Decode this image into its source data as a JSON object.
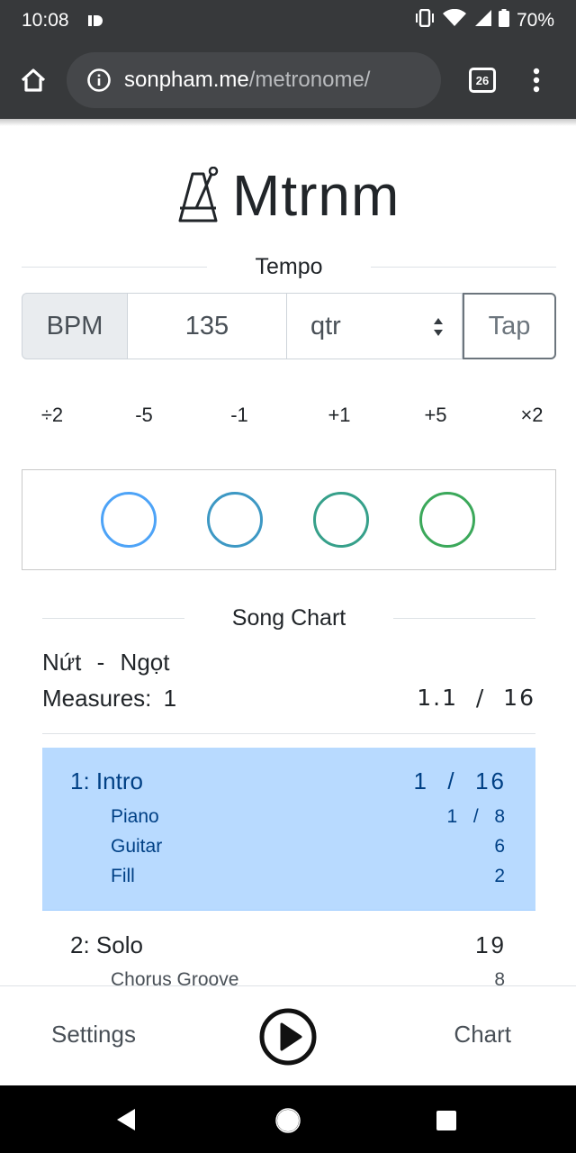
{
  "status_bar": {
    "time": "10:08",
    "battery": "70%"
  },
  "browser": {
    "url_host": "sonpham.me",
    "url_path": "/metronome/",
    "tab_count": "26"
  },
  "app": {
    "title": "Mtrnm"
  },
  "tempo": {
    "section_title": "Tempo",
    "bpm_label": "BPM",
    "bpm_value": "135",
    "note_value": "qtr",
    "tap_label": "Tap",
    "adjust_buttons": [
      "÷2",
      "-5",
      "-1",
      "+1",
      "+5",
      "×2"
    ]
  },
  "beats": {
    "count": 4,
    "colors": [
      "#4da3f7",
      "#3d98c4",
      "#36a08a",
      "#3ba85a"
    ]
  },
  "song_chart": {
    "section_title": "Song Chart",
    "artist": "Nứt",
    "separator": "-",
    "song": "Ngọt",
    "measures_label": "Measures:",
    "measures_value": "1",
    "position": "1.1  /  16",
    "sections": [
      {
        "name": "1: Intro",
        "count": "1  /  16",
        "active": true,
        "parts": [
          {
            "name": "Piano",
            "count": "1  /  8"
          },
          {
            "name": "Guitar",
            "count": "6"
          },
          {
            "name": "Fill",
            "count": "2"
          }
        ]
      },
      {
        "name": "2: Solo",
        "count": "19",
        "active": false,
        "parts": [
          {
            "name": "Chorus Groove",
            "count": "8"
          }
        ]
      }
    ]
  },
  "toolbar": {
    "settings_label": "Settings",
    "chart_label": "Chart"
  },
  "colors": {
    "active_section_bg": "#b8daff",
    "active_section_text": "#004085",
    "chrome_bar": "#37393b"
  }
}
